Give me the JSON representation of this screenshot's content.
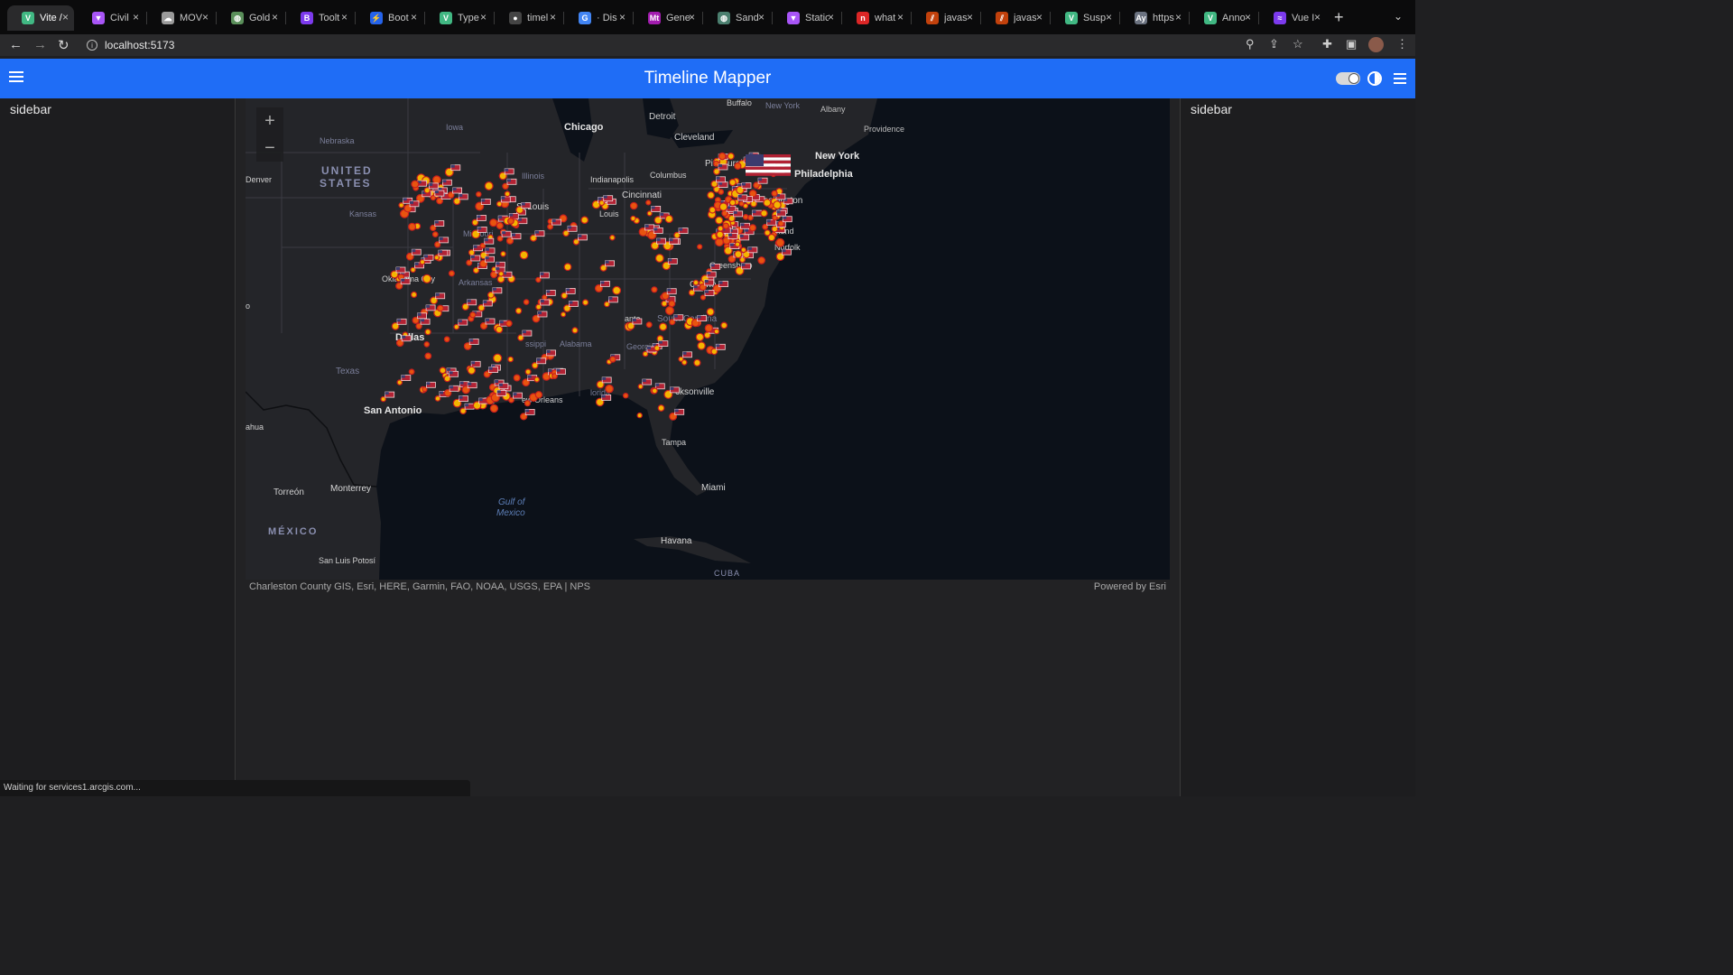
{
  "browser": {
    "tabs": [
      {
        "title": "Vite /",
        "fav": "V",
        "color": "#41b883",
        "active": true
      },
      {
        "title": "Civil",
        "fav": "▼",
        "color": "#a855f7"
      },
      {
        "title": "MOV",
        "fav": "☁",
        "color": "#9a9a9a"
      },
      {
        "title": "Gold",
        "fav": "◍",
        "color": "#5a8f5a"
      },
      {
        "title": "Toolt",
        "fav": "B",
        "color": "#7c3aed"
      },
      {
        "title": "Boot",
        "fav": "⚡",
        "color": "#2563eb"
      },
      {
        "title": "Type",
        "fav": "V",
        "color": "#41b883"
      },
      {
        "title": "timel",
        "fav": "●",
        "color": "#444444"
      },
      {
        "title": "· Dis",
        "fav": "G",
        "color": "#4285f4"
      },
      {
        "title": "Gene",
        "fav": "Mt",
        "color": "#a21caf"
      },
      {
        "title": "Sand",
        "fav": "◍",
        "color": "#4b7f6f"
      },
      {
        "title": "Static",
        "fav": "▼",
        "color": "#a855f7"
      },
      {
        "title": "what",
        "fav": "n",
        "color": "#dc2626"
      },
      {
        "title": "javas",
        "fav": "⫽",
        "color": "#c2410c"
      },
      {
        "title": "javas",
        "fav": "⫽",
        "color": "#c2410c"
      },
      {
        "title": "Susp",
        "fav": "V",
        "color": "#41b883"
      },
      {
        "title": "https",
        "fav": "Ay",
        "color": "#6b7280"
      },
      {
        "title": "Anno",
        "fav": "V",
        "color": "#41b883"
      },
      {
        "title": "Vue I",
        "fav": "≈",
        "color": "#7c3aed"
      }
    ],
    "url": "localhost:5173",
    "status": "Waiting for services1.arcgis.com..."
  },
  "app": {
    "title": "Timeline Mapper",
    "left_sidebar": "sidebar",
    "right_sidebar": "sidebar"
  },
  "map": {
    "zoom_in": "+",
    "zoom_out": "−",
    "attribution": "Charleston County GIS, Esri, HERE, Garmin, FAO, NOAA, USGS, EPA | NPS",
    "powered_by": "Powered by Esri",
    "labels": {
      "chicago": "Chicago",
      "detroit": "Detroit",
      "buffalo": "Buffalo",
      "new_york_state": "New York",
      "albany": "Albany",
      "providence": "Providence",
      "cleveland": "Cleveland",
      "pittsburgh": "Pittsburgh",
      "new_york": "New York",
      "philadelphia": "Philadelphia",
      "washington": "ashington",
      "nebraska": "Nebraska",
      "iowa": "Iowa",
      "illinois": "Illinois",
      "indianapolis": "Indianapolis",
      "columbus": "Columbus",
      "cincinnati": "Cincinnati",
      "united": "UNITED",
      "states": "STATES",
      "denver": "Denver",
      "kansas": "Kansas",
      "st_louis": "St Louis",
      "missouri": "Missouri",
      "louis": "Louis",
      "richmond": "mond",
      "norfolk": "Norfolk",
      "greensboro": "Greensboro",
      "charlotte": "Charlo",
      "oklahoma_city": "Oklahoma City",
      "arkansas": "Arkansas",
      "south_carolina": "South Carolina",
      "atlanta": "anta",
      "georgia": "Georgia",
      "alabama": "Alabama",
      "mississippi": "ssippi",
      "dallas": "Dallas",
      "texas": "Texas",
      "san_antonio": "San Antonio",
      "new_orleans": "ew Orleans",
      "florida": "lorida",
      "jacksonville": "cksonville",
      "tampa": "Tampa",
      "miami": "Miami",
      "chihuahua": "ahua",
      "torreon": "Torreón",
      "monterrey": "Monterrey",
      "gulf1": "Gulf of",
      "gulf2": "Mexico",
      "mexico": "MÉXICO",
      "san_luis_potosi": "San Luis Potosí",
      "havana": "Havana",
      "cuba": "CUBA",
      "o_label": "o"
    }
  }
}
